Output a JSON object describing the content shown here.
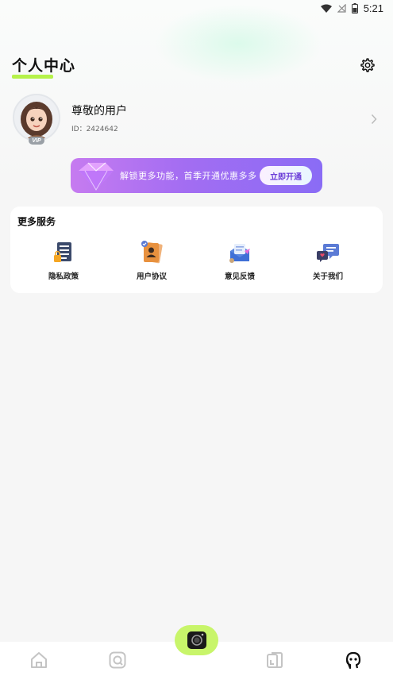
{
  "status_bar": {
    "time": "5:21",
    "icons": [
      "wifi-icon",
      "no-signal-icon",
      "battery-icon"
    ]
  },
  "header": {
    "title": "个人中心",
    "settings_icon": "gear-icon"
  },
  "profile": {
    "name": "尊敬的用户",
    "id_text": "ID：2424642",
    "vip_badge": "VIP"
  },
  "vip_banner": {
    "text": "解锁更多功能，首季开通优惠多多",
    "button_label": "立即开通"
  },
  "services": {
    "title": "更多服务",
    "items": [
      {
        "label": "隐私政策",
        "icon": "privacy-policy-icon"
      },
      {
        "label": "用户协议",
        "icon": "user-agreement-icon"
      },
      {
        "label": "意见反馈",
        "icon": "feedback-icon"
      },
      {
        "label": "关于我们",
        "icon": "about-us-icon"
      }
    ]
  },
  "bottom_nav": {
    "items": [
      "home-icon",
      "edit-icon",
      "camera-icon",
      "gallery-icon",
      "profile-icon"
    ],
    "active": "profile-icon"
  },
  "colors": {
    "accent": "#b5f24a",
    "camera_button": "#c8f56a",
    "banner_start": "#c67bf0",
    "banner_end": "#8a6cf5"
  }
}
